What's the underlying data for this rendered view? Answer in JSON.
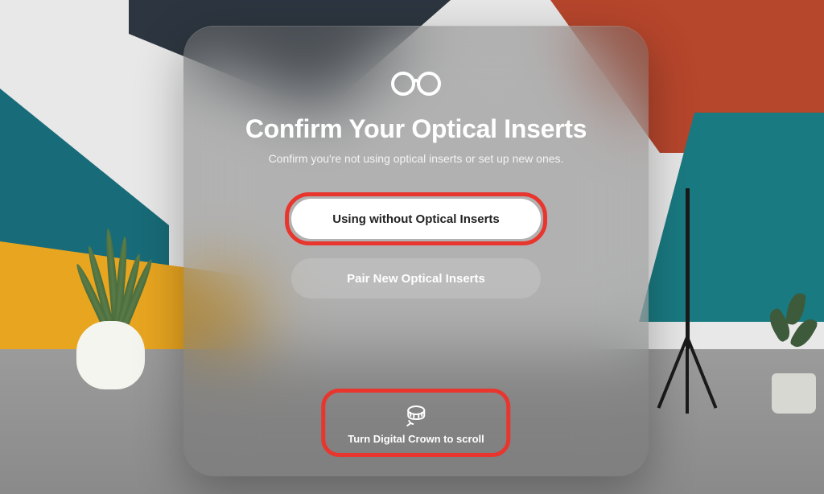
{
  "dialog": {
    "title": "Confirm Your Optical Inserts",
    "subtitle": "Confirm you're not using optical inserts or set up new ones.",
    "primary_button": "Using without Optical Inserts",
    "secondary_button": "Pair New Optical Inserts"
  },
  "hint": {
    "text": "Turn Digital Crown to scroll"
  },
  "icons": {
    "glasses": "glasses-icon",
    "digital_crown": "digital-crown-icon"
  }
}
